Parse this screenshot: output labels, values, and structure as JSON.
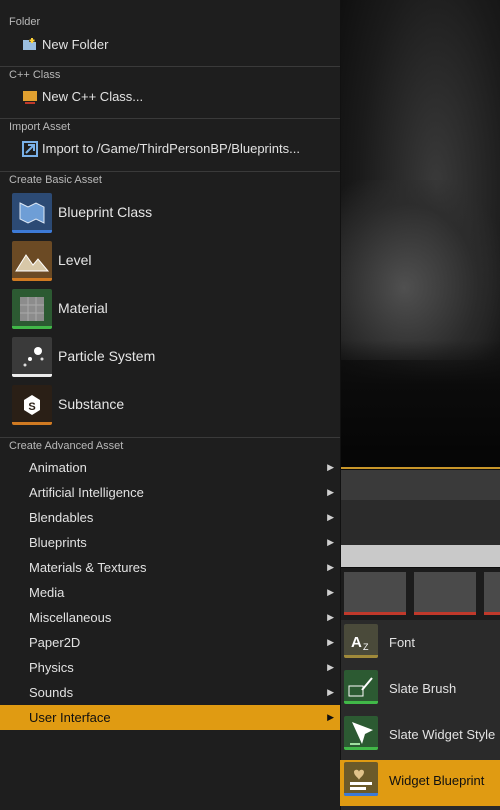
{
  "sections": {
    "folder": "Folder",
    "cpp": "C++ Class",
    "import": "Import Asset",
    "basic": "Create Basic Asset",
    "advanced": "Create Advanced Asset"
  },
  "items": {
    "new_folder": "New Folder",
    "new_cpp": "New C++ Class...",
    "import_to": "Import to /Game/ThirdPersonBP/Blueprints..."
  },
  "basic_assets": [
    {
      "label": "Blueprint Class",
      "color": "#3d7ad6"
    },
    {
      "label": "Level",
      "color": "#d07a22"
    },
    {
      "label": "Material",
      "color": "#41b848"
    },
    {
      "label": "Particle System",
      "color": "#ededed"
    },
    {
      "label": "Substance",
      "color": "#d07a22"
    }
  ],
  "advanced": [
    {
      "label": "Animation"
    },
    {
      "label": "Artificial Intelligence"
    },
    {
      "label": "Blendables"
    },
    {
      "label": "Blueprints"
    },
    {
      "label": "Materials & Textures"
    },
    {
      "label": "Media"
    },
    {
      "label": "Miscellaneous"
    },
    {
      "label": "Paper2D"
    },
    {
      "label": "Physics"
    },
    {
      "label": "Sounds"
    },
    {
      "label": "User Interface",
      "active": true
    }
  ],
  "submenu": [
    {
      "label": "Font"
    },
    {
      "label": "Slate Brush"
    },
    {
      "label": "Slate Widget Style"
    },
    {
      "label": "Widget Blueprint",
      "active": true
    }
  ],
  "colors": {
    "accent": "#e09b12",
    "menu_bg": "#1e1e1e"
  }
}
